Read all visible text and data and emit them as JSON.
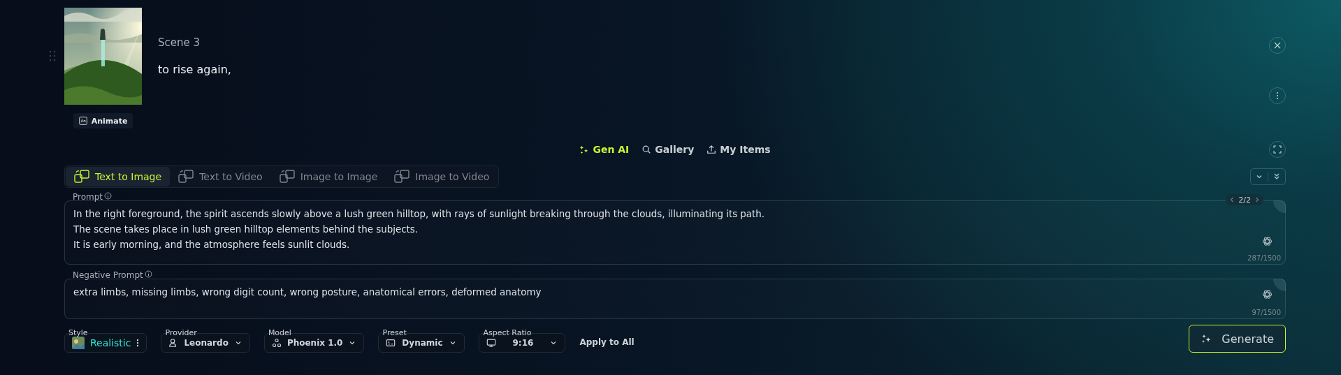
{
  "scene": {
    "title": "Scene 3",
    "text": "to rise again,",
    "animate": "Animate"
  },
  "nav": [
    {
      "label": "Gen AI",
      "selected": true
    },
    {
      "label": "Gallery",
      "selected": false
    },
    {
      "label": "My Items",
      "selected": false
    }
  ],
  "tabs": [
    {
      "label": "Text to Image",
      "selected": true
    },
    {
      "label": "Text to Video",
      "selected": false
    },
    {
      "label": "Image to Image",
      "selected": false
    },
    {
      "label": "Image to Video",
      "selected": false
    }
  ],
  "prompt": {
    "label": "Prompt",
    "page": "2/2",
    "value": "In the right foreground, the spirit ascends slowly above a lush green hilltop, with rays of sunlight breaking through the clouds, illuminating its path.\nThe scene takes place in lush green hilltop elements behind the subjects.\nIt is early morning, and the atmosphere feels sunlit clouds.",
    "counter": "287/1500"
  },
  "negative_prompt": {
    "label": "Negative Prompt",
    "value": "extra limbs, missing limbs, wrong digit count, wrong posture, anatomical errors, deformed anatomy",
    "counter": "97/1500"
  },
  "controls": [
    {
      "kind": "style",
      "label": "Style",
      "value": "Realistic"
    },
    {
      "kind": "select",
      "label": "Provider",
      "value": "Leonardo"
    },
    {
      "kind": "select",
      "label": "Model",
      "value": "Phoenix 1.0"
    },
    {
      "kind": "select",
      "label": "Preset",
      "value": "Dynamic"
    },
    {
      "kind": "select",
      "label": "Aspect Ratio",
      "value": "9:16"
    }
  ],
  "apply_all": "Apply to All",
  "generate": "Generate"
}
